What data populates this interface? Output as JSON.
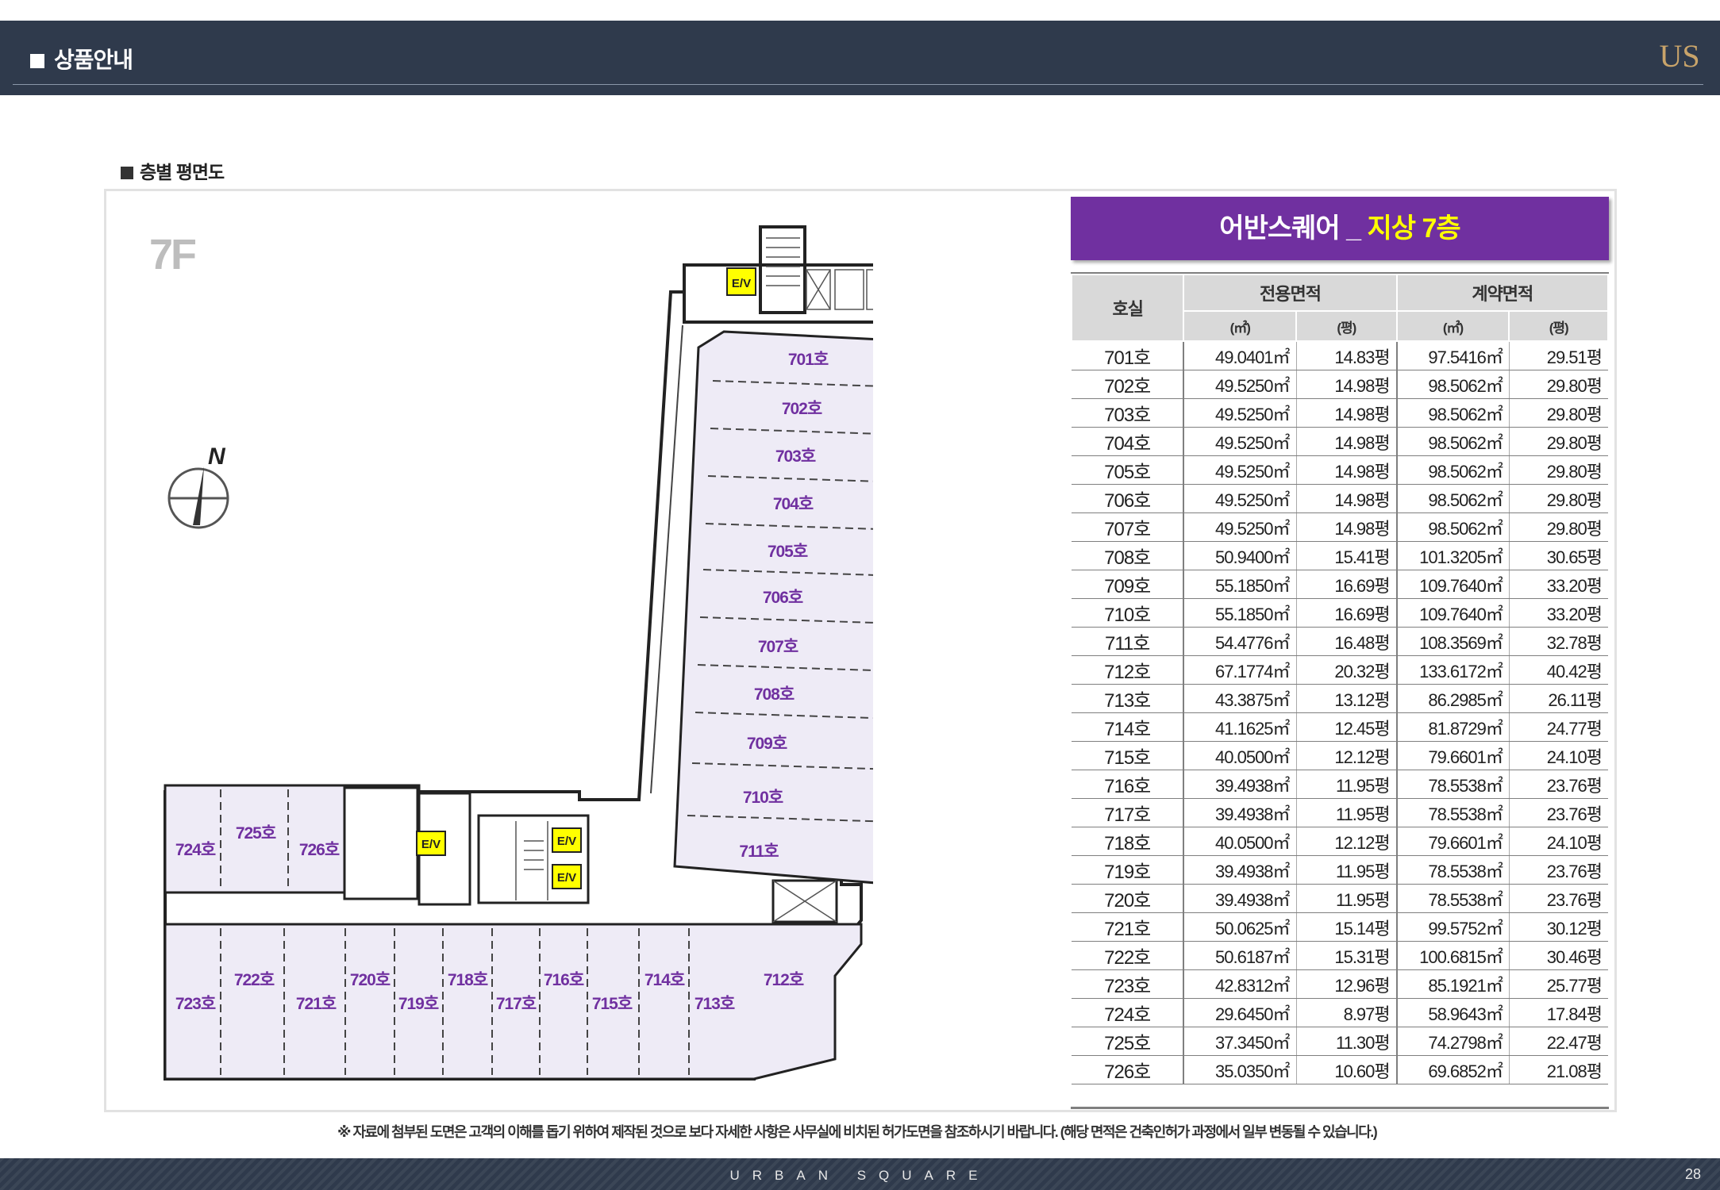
{
  "header": {
    "title": "상품안내",
    "logo": "US"
  },
  "section": {
    "label": "층별 평면도"
  },
  "plan": {
    "floor": "7F",
    "north": "N",
    "ev": "E/V",
    "units": [
      "701호",
      "702호",
      "703호",
      "704호",
      "705호",
      "706호",
      "707호",
      "708호",
      "709호",
      "710호",
      "711호",
      "712호",
      "713호",
      "714호",
      "715호",
      "716호",
      "717호",
      "718호",
      "719호",
      "720호",
      "721호",
      "722호",
      "723호",
      "724호",
      "725호",
      "726호"
    ]
  },
  "table": {
    "title_prefix": "어반스퀘어 _ ",
    "title_highlight": "지상 7층",
    "headers": {
      "unit": "호실",
      "exclusive": "전용면적",
      "contract": "계약면적",
      "m2": "(㎡)",
      "pyeong": "(평)"
    },
    "rows": [
      [
        "701호",
        "49.0401㎡",
        "14.83평",
        "97.5416㎡",
        "29.51평"
      ],
      [
        "702호",
        "49.5250㎡",
        "14.98평",
        "98.5062㎡",
        "29.80평"
      ],
      [
        "703호",
        "49.5250㎡",
        "14.98평",
        "98.5062㎡",
        "29.80평"
      ],
      [
        "704호",
        "49.5250㎡",
        "14.98평",
        "98.5062㎡",
        "29.80평"
      ],
      [
        "705호",
        "49.5250㎡",
        "14.98평",
        "98.5062㎡",
        "29.80평"
      ],
      [
        "706호",
        "49.5250㎡",
        "14.98평",
        "98.5062㎡",
        "29.80평"
      ],
      [
        "707호",
        "49.5250㎡",
        "14.98평",
        "98.5062㎡",
        "29.80평"
      ],
      [
        "708호",
        "50.9400㎡",
        "15.41평",
        "101.3205㎡",
        "30.65평"
      ],
      [
        "709호",
        "55.1850㎡",
        "16.69평",
        "109.7640㎡",
        "33.20평"
      ],
      [
        "710호",
        "55.1850㎡",
        "16.69평",
        "109.7640㎡",
        "33.20평"
      ],
      [
        "711호",
        "54.4776㎡",
        "16.48평",
        "108.3569㎡",
        "32.78평"
      ],
      [
        "712호",
        "67.1774㎡",
        "20.32평",
        "133.6172㎡",
        "40.42평"
      ],
      [
        "713호",
        "43.3875㎡",
        "13.12평",
        "86.2985㎡",
        "26.11평"
      ],
      [
        "714호",
        "41.1625㎡",
        "12.45평",
        "81.8729㎡",
        "24.77평"
      ],
      [
        "715호",
        "40.0500㎡",
        "12.12평",
        "79.6601㎡",
        "24.10평"
      ],
      [
        "716호",
        "39.4938㎡",
        "11.95평",
        "78.5538㎡",
        "23.76평"
      ],
      [
        "717호",
        "39.4938㎡",
        "11.95평",
        "78.5538㎡",
        "23.76평"
      ],
      [
        "718호",
        "40.0500㎡",
        "12.12평",
        "79.6601㎡",
        "24.10평"
      ],
      [
        "719호",
        "39.4938㎡",
        "11.95평",
        "78.5538㎡",
        "23.76평"
      ],
      [
        "720호",
        "39.4938㎡",
        "11.95평",
        "78.5538㎡",
        "23.76평"
      ],
      [
        "721호",
        "50.0625㎡",
        "15.14평",
        "99.5752㎡",
        "30.12평"
      ],
      [
        "722호",
        "50.6187㎡",
        "15.31평",
        "100.6815㎡",
        "30.46평"
      ],
      [
        "723호",
        "42.8312㎡",
        "12.96평",
        "85.1921㎡",
        "25.77평"
      ],
      [
        "724호",
        "29.6450㎡",
        "8.97평",
        "58.9643㎡",
        "17.84평"
      ],
      [
        "725호",
        "37.3450㎡",
        "11.30평",
        "74.2798㎡",
        "22.47평"
      ],
      [
        "726호",
        "35.0350㎡",
        "10.60평",
        "69.6852㎡",
        "21.08평"
      ]
    ]
  },
  "footnote": "※ 자료에 첨부된 도면은 고객의 이해를 돕기 위하여 제작된 것으로 보다 자세한 사항은 사무실에 비치된 허가도면을 참조하시기 바랍니다. (해당 면적은 건축인허가 과정에서 일부 변동될 수 있습니다.)",
  "footer": {
    "brand": "URBAN SQUARE",
    "page": "28"
  },
  "colors": {
    "header_bg": "#2f3a4c",
    "title_bg": "#7030a0",
    "title_highlight": "#ffff00",
    "unit_label": "#7030a0",
    "unit_fill": "#eeebf6"
  }
}
